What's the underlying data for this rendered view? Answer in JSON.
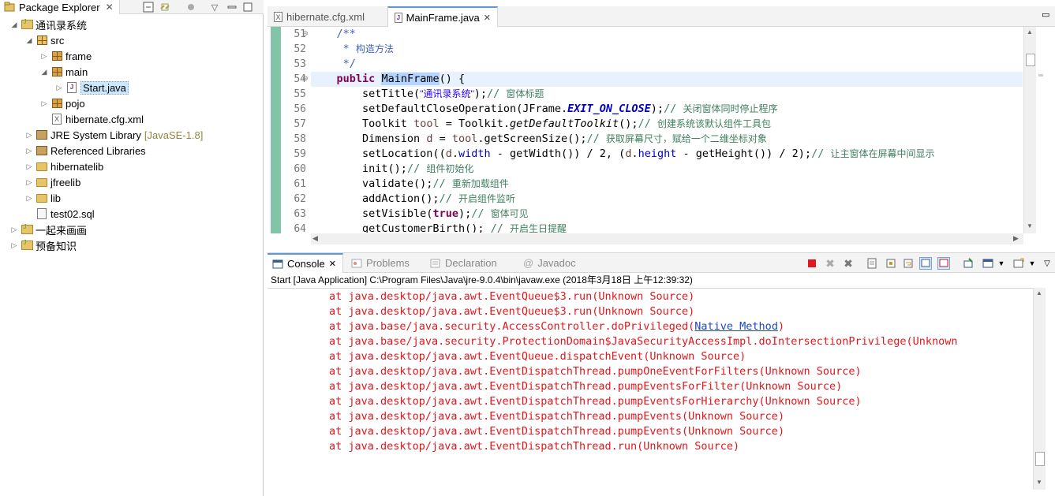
{
  "package_explorer": {
    "tab_label": "Package Explorer",
    "tree": [
      {
        "label": "通讯录系统",
        "icon": "project-icon"
      },
      {
        "label": "src",
        "icon": "source-folder-icon"
      },
      {
        "label": "frame",
        "icon": "package-icon"
      },
      {
        "label": "main",
        "icon": "package-icon"
      },
      {
        "label": "Start.java",
        "icon": "java-file-icon"
      },
      {
        "label": "pojo",
        "icon": "package-icon"
      },
      {
        "label": "hibernate.cfg.xml",
        "icon": "xml-file-icon"
      },
      {
        "label": "JRE System Library",
        "suffix": "[JavaSE-1.8]",
        "icon": "library-icon"
      },
      {
        "label": "Referenced Libraries",
        "icon": "library-icon"
      },
      {
        "label": "hibernatelib",
        "icon": "folder-icon"
      },
      {
        "label": "jfreelib",
        "icon": "folder-icon"
      },
      {
        "label": "lib",
        "icon": "folder-icon"
      },
      {
        "label": "test02.sql",
        "icon": "sql-file-icon"
      },
      {
        "label": "一起来画画",
        "icon": "project-icon"
      },
      {
        "label": "预备知识",
        "icon": "project-icon"
      }
    ]
  },
  "editor": {
    "tabs": [
      {
        "label": "hibernate.cfg.xml"
      },
      {
        "label": "MainFrame.java"
      }
    ],
    "line_numbers": [
      "51",
      "52",
      "53",
      "54",
      "55",
      "56",
      "57",
      "58",
      "59",
      "60",
      "61",
      "62",
      "63",
      "64"
    ],
    "lines": {
      "l51": "/**",
      "l52a": " * ",
      "l52b": "构造方法",
      "l53": " */",
      "l54_kw": "public",
      "l54_name": "MainFrame",
      "l54_rest": "() {",
      "l55a": "setTitle(",
      "l55b": "\"通讯录系统\"",
      "l55c": ");",
      "l55d": "// ",
      "l55e": "窗体标题",
      "l56a": "setDefaultCloseOperation(JFrame.",
      "l56b": "EXIT_ON_CLOSE",
      "l56c": ");",
      "l56d": "// ",
      "l56e": "关闭窗体同时停止程序",
      "l57a": "Toolkit ",
      "l57b": "tool",
      "l57c": " = Toolkit.",
      "l57d": "getDefaultToolkit",
      "l57e": "();",
      "l57f": "// ",
      "l57g": "创建系统该默认组件工具包",
      "l58a": "Dimension ",
      "l58b": "d",
      "l58c": " = ",
      "l58d": "tool",
      "l58e": ".getScreenSize();",
      "l58f": "// ",
      "l58g": "获取屏幕尺寸，赋给一个二维坐标对象",
      "l59a": "setLocation((",
      "l59b": "d",
      "l59c": ".",
      "l59d": "width",
      "l59e": " - getWidth()) / 2, (",
      "l59f": "d",
      "l59g": ".",
      "l59h": "height",
      "l59i": " - getHeight()) / 2);",
      "l59j": "// ",
      "l59k": "让主窗体在屏幕中间显示",
      "l60a": "init();",
      "l60b": "// ",
      "l60c": "组件初始化",
      "l61a": "validate();",
      "l61b": "// ",
      "l61c": "重新加载组件",
      "l62a": "addAction();",
      "l62b": "// ",
      "l62c": "开启组件监听",
      "l63a": "setVisible(",
      "l63b": "true",
      "l63c": ");",
      "l63d": "// ",
      "l63e": "窗体可见",
      "l64a": "getCustomerBirth();",
      "l64b": " // ",
      "l64c": "开启生日提醒"
    }
  },
  "console": {
    "tabs": [
      {
        "label": "Console"
      },
      {
        "label": "Problems"
      },
      {
        "label": "Declaration"
      },
      {
        "label": "Javadoc"
      }
    ],
    "description": "Start [Java Application] C:\\Program Files\\Java\\jre-9.0.4\\bin\\javaw.exe (2018年3月18日 上午12:39:32)",
    "stack": [
      "at java.desktop/java.awt.EventQueue$3.run(Unknown Source)",
      "at java.desktop/java.awt.EventQueue$3.run(Unknown Source)",
      "at java.base/java.security.AccessController.doPrivileged(",
      "at java.base/java.security.ProtectionDomain$JavaSecurityAccessImpl.doIntersectionPrivilege(Unknown",
      "at java.desktop/java.awt.EventQueue.dispatchEvent(Unknown Source)",
      "at java.desktop/java.awt.EventDispatchThread.pumpOneEventForFilters(Unknown Source)",
      "at java.desktop/java.awt.EventDispatchThread.pumpEventsForFilter(Unknown Source)",
      "at java.desktop/java.awt.EventDispatchThread.pumpEventsForHierarchy(Unknown Source)",
      "at java.desktop/java.awt.EventDispatchThread.pumpEvents(Unknown Source)",
      "at java.desktop/java.awt.EventDispatchThread.pumpEvents(Unknown Source)",
      "at java.desktop/java.awt.EventDispatchThread.run(Unknown Source)"
    ],
    "native_link": "Native Method",
    "native_after": ")"
  },
  "colors": {
    "keyword": "#7f0055",
    "comment": "#3f7f5f",
    "string": "#2a00ff",
    "field": "#0000c0",
    "error": "#e4161b",
    "ruler": "#82c4a8"
  }
}
